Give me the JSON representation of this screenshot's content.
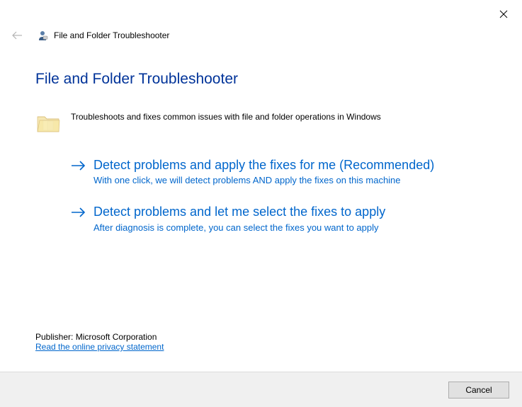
{
  "window": {
    "title": "File and Folder Troubleshooter"
  },
  "page": {
    "heading": "File and Folder Troubleshooter",
    "intro": "Troubleshoots and fixes common issues with file and folder operations in Windows"
  },
  "options": [
    {
      "title": "Detect problems and apply the fixes for me (Recommended)",
      "description": "With one click, we will detect problems AND apply the fixes on this machine"
    },
    {
      "title": "Detect problems and let me select the fixes to apply",
      "description": "After diagnosis is complete, you can select the fixes you want to apply"
    }
  ],
  "publisher": {
    "label": "Publisher: Microsoft Corporation",
    "privacy_link": "Read the online privacy statement"
  },
  "footer": {
    "cancel_label": "Cancel"
  }
}
